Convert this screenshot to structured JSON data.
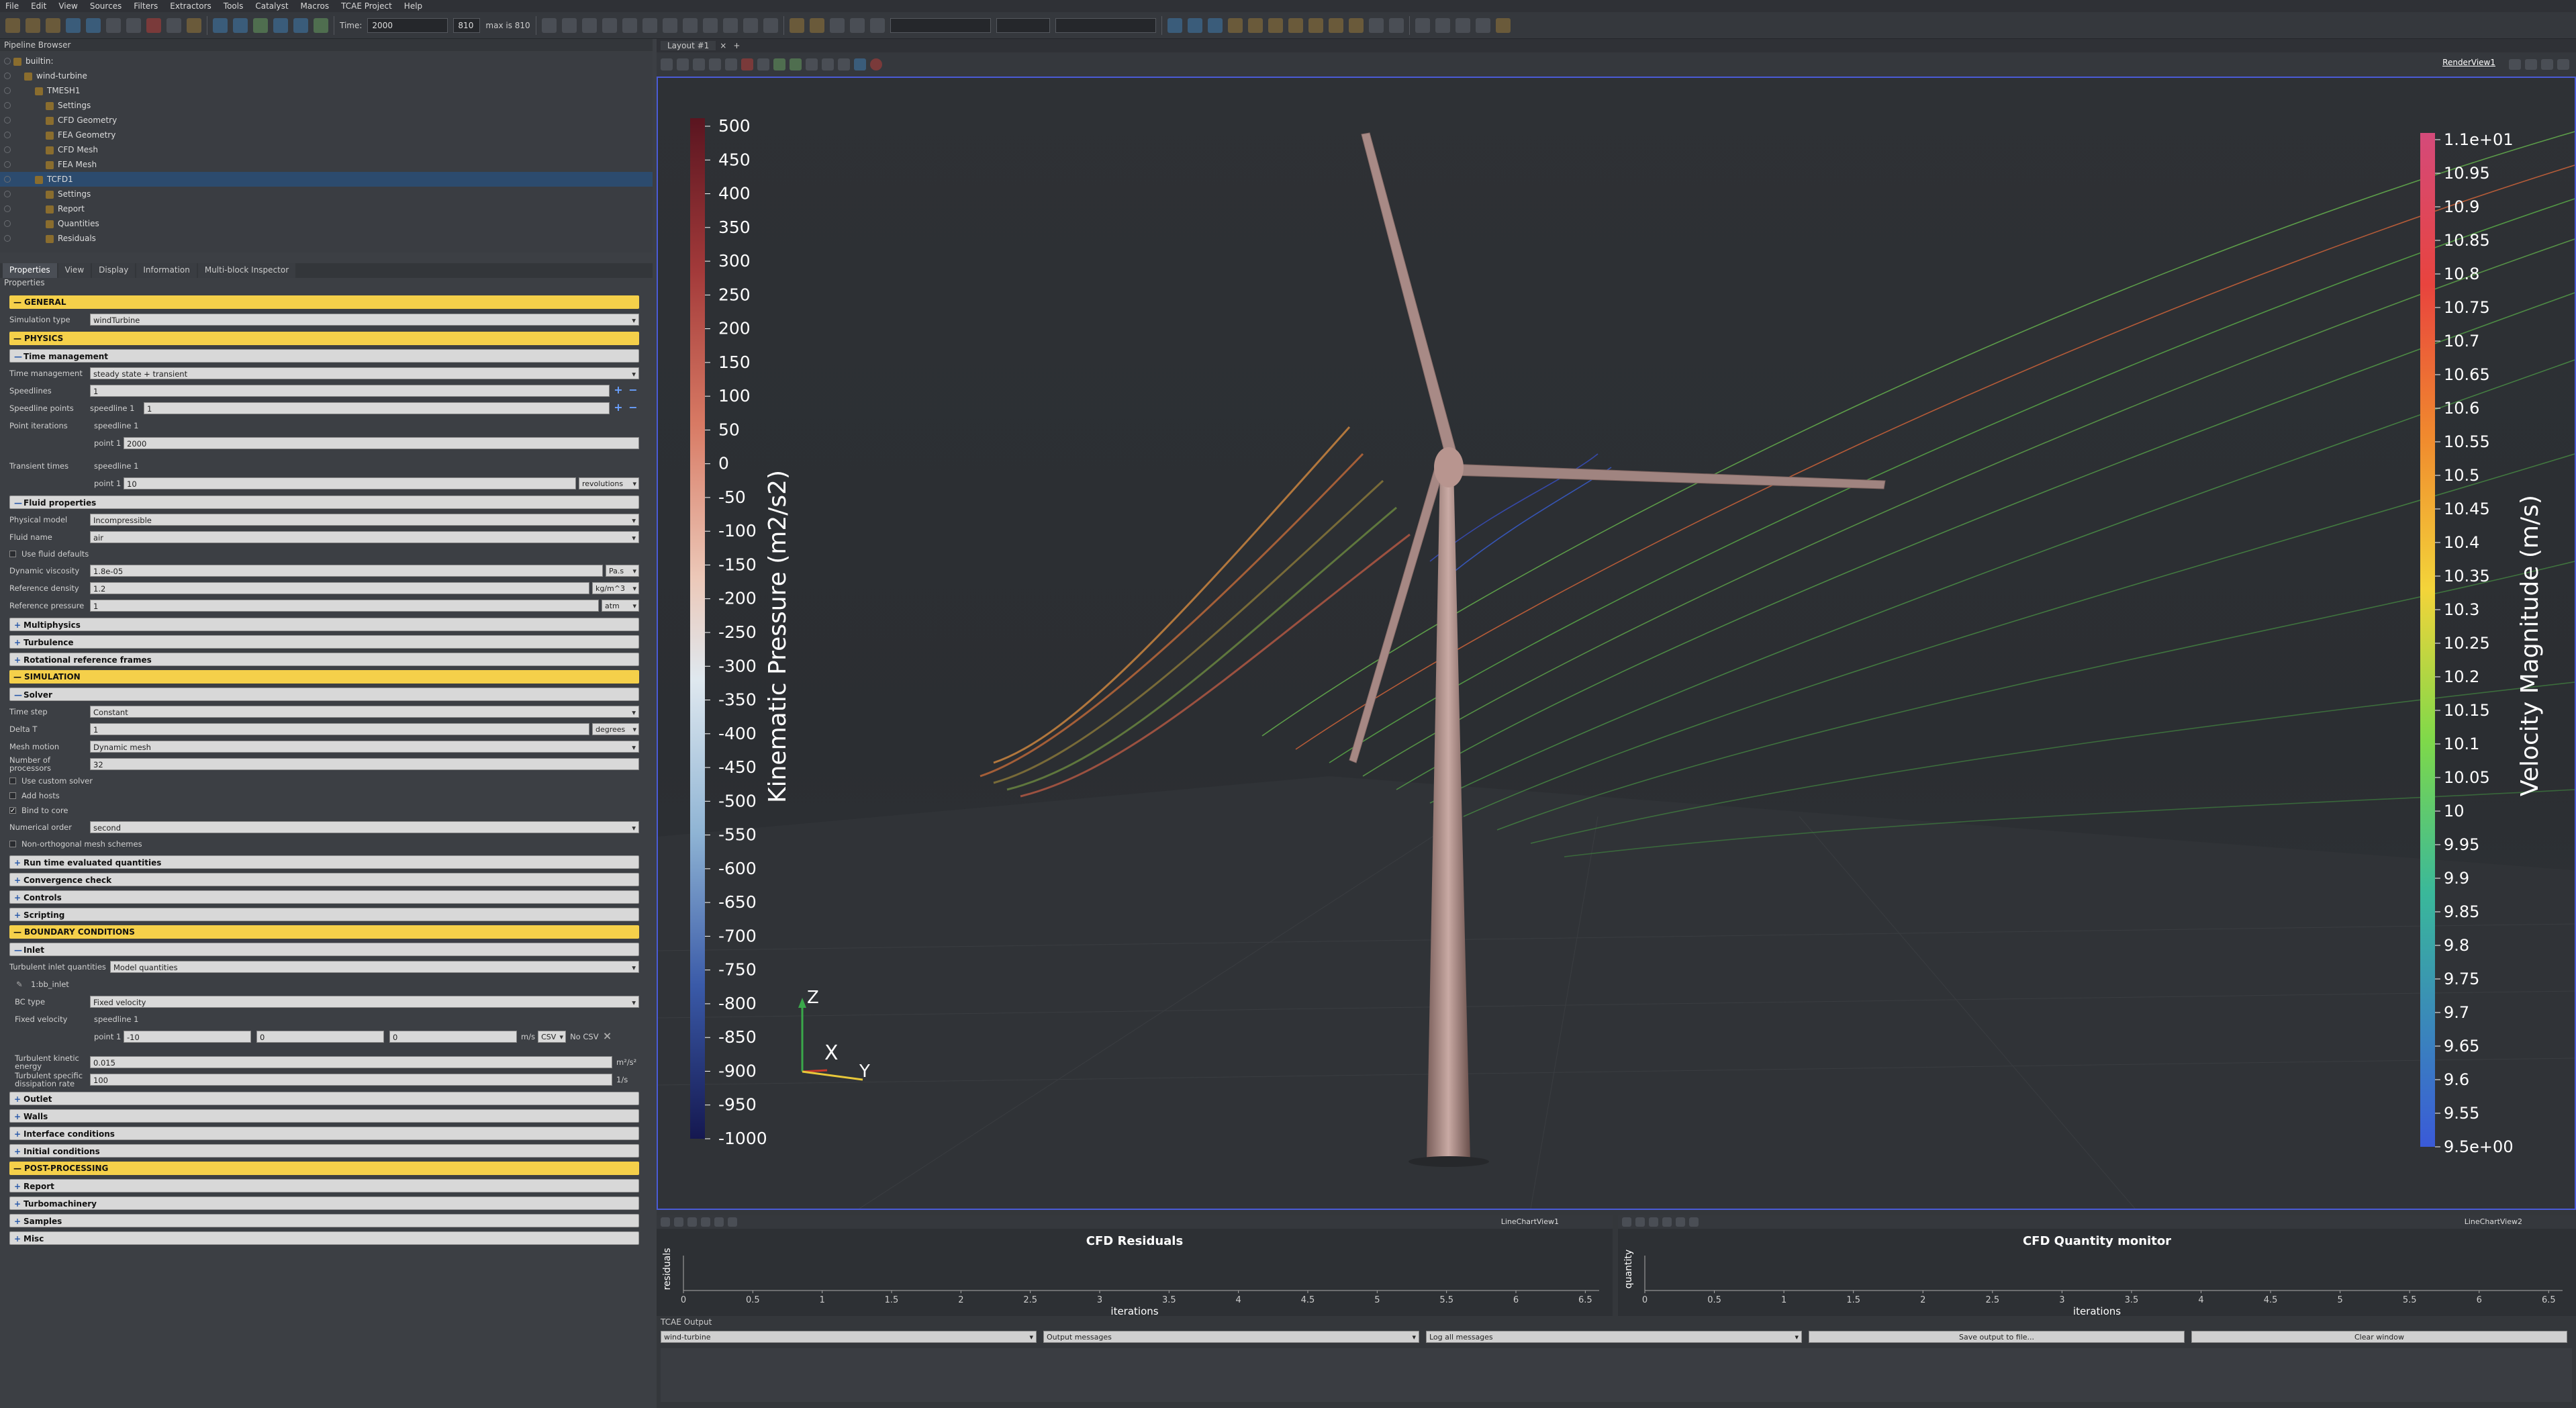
{
  "menu": [
    "File",
    "Edit",
    "View",
    "Sources",
    "Filters",
    "Extractors",
    "Tools",
    "Catalyst",
    "Macros",
    "TCAE Project",
    "Help"
  ],
  "toolbar": {
    "time_label": "Time:",
    "time_value": "2000",
    "step_value": "810",
    "max_label": "max is 810"
  },
  "pipeline": {
    "title": "Pipeline Browser",
    "items": [
      {
        "label": "builtin:",
        "indent": 0
      },
      {
        "label": "wind-turbine",
        "indent": 1
      },
      {
        "label": "TMESH1",
        "indent": 2
      },
      {
        "label": "Settings",
        "indent": 3
      },
      {
        "label": "CFD Geometry",
        "indent": 3
      },
      {
        "label": "FEA Geometry",
        "indent": 3
      },
      {
        "label": "CFD Mesh",
        "indent": 3
      },
      {
        "label": "FEA Mesh",
        "indent": 3
      },
      {
        "label": "TCFD1",
        "indent": 2,
        "selected": true
      },
      {
        "label": "Settings",
        "indent": 3
      },
      {
        "label": "Report",
        "indent": 3
      },
      {
        "label": "Quantities",
        "indent": 3
      },
      {
        "label": "Residuals",
        "indent": 3
      }
    ]
  },
  "tabs": [
    "Properties",
    "View",
    "Display",
    "Information",
    "Multi-block Inspector"
  ],
  "properties_title": "Properties",
  "general": {
    "title": "GENERAL",
    "sim_type_label": "Simulation type",
    "sim_type": "windTurbine"
  },
  "physics": {
    "title": "PHYSICS",
    "time_mgmt": {
      "title": "Time management",
      "tm_label": "Time management",
      "tm_value": "steady state + transient",
      "speedlines_label": "Speedlines",
      "speedlines_value": "1",
      "speedline_points_label": "Speedline points",
      "sp_name": "speedline 1",
      "sp_value": "1",
      "point_iter_label": "Point iterations",
      "pi_name": "speedline 1",
      "pi_point": "point 1",
      "pi_value": "2000",
      "transient_label": "Transient times",
      "tt_name": "speedline 1",
      "tt_point": "point 1",
      "tt_value": "10",
      "tt_unit": "revolutions"
    },
    "fluid": {
      "title": "Fluid properties",
      "pm_label": "Physical model",
      "pm_value": "Incompressible",
      "fn_label": "Fluid name",
      "fn_value": "air",
      "defaults_label": "Use fluid defaults",
      "dv_label": "Dynamic viscosity",
      "dv_value": "1.8e-05",
      "dv_unit": "Pa.s",
      "rd_label": "Reference density",
      "rd_value": "1.2",
      "rd_unit": "kg/m^3",
      "rp_label": "Reference pressure",
      "rp_value": "1",
      "rp_unit": "atm"
    },
    "collapsed": [
      "Multiphysics",
      "Turbulence",
      "Rotational reference frames"
    ]
  },
  "simulation": {
    "title": "SIMULATION",
    "solver": {
      "title": "Solver",
      "ts_label": "Time step",
      "ts_value": "Constant",
      "dt_label": "Delta T",
      "dt_value": "1",
      "dt_unit": "degrees",
      "mm_label": "Mesh motion",
      "mm_value": "Dynamic mesh",
      "np_label": "Number of processors",
      "np_value": "32",
      "custom_solver": "Use custom solver",
      "add_hosts": "Add hosts",
      "bind_core": "Bind to core",
      "no_label": "Numerical order",
      "no_value": "second",
      "nonortho": "Non-orthogonal mesh schemes"
    },
    "collapsed": [
      "Run time evaluated quantities",
      "Convergence check",
      "Controls",
      "Scripting"
    ]
  },
  "boundary": {
    "title": "BOUNDARY CONDITIONS",
    "inlet": {
      "title": "Inlet",
      "tiq_label": "Turbulent inlet quantities",
      "tiq_value": "Model quantities",
      "patch": "1:bb_inlet",
      "bc_label": "BC type",
      "bc_value": "Fixed velocity",
      "fv_label": "Fixed velocity",
      "fv_name": "speedline 1",
      "fv_point": "point 1",
      "fv_x": "-10",
      "fv_y": "0",
      "fv_z": "0",
      "fv_unit": "m/s",
      "fv_csv": "CSV",
      "fv_nocsv": "No CSV",
      "tke_label": "Turbulent kinetic energy",
      "tke_value": "0.015",
      "tke_unit": "m²/s²",
      "tsd_label": "Turbulent specific dissipation rate",
      "tsd_value": "100",
      "tsd_unit": "1/s"
    },
    "collapsed": [
      "Outlet",
      "Walls",
      "Interface conditions",
      "Initial conditions"
    ]
  },
  "post": {
    "title": "POST-PROCESSING",
    "collapsed": [
      "Report",
      "Turbomachinery",
      "Samples",
      "Misc"
    ]
  },
  "layout": {
    "tab": "Layout #1",
    "view_name": "RenderView1"
  },
  "pressure_bar": {
    "title": "Kinematic Pressure (m2/s2)",
    "ticks": [
      "500",
      "450",
      "400",
      "350",
      "300",
      "250",
      "200",
      "150",
      "100",
      "50",
      "0",
      "-50",
      "-100",
      "-150",
      "-200",
      "-250",
      "-300",
      "-350",
      "-400",
      "-450",
      "-500",
      "-550",
      "-600",
      "-650",
      "-700",
      "-750",
      "-800",
      "-850",
      "-900",
      "-950",
      "-1000"
    ]
  },
  "velocity_bar": {
    "title": "Velocity Magnitude (m/s)",
    "ticks": [
      "1.1e+01",
      "10.95",
      "10.9",
      "10.85",
      "10.8",
      "10.75",
      "10.7",
      "10.65",
      "10.6",
      "10.55",
      "10.5",
      "10.45",
      "10.4",
      "10.35",
      "10.3",
      "10.25",
      "10.2",
      "10.15",
      "10.1",
      "10.05",
      "10",
      "9.95",
      "9.9",
      "9.85",
      "9.8",
      "9.75",
      "9.7",
      "9.65",
      "9.6",
      "9.55",
      "9.5e+00"
    ]
  },
  "axes": {
    "z": "Z",
    "x": "X",
    "y": "Y"
  },
  "charts": [
    {
      "view": "LineChartView1",
      "title": "CFD Residuals",
      "ylabel": "residuals",
      "xlabel": "iterations"
    },
    {
      "view": "LineChartView2",
      "title": "CFD Quantity monitor",
      "ylabel": "quantity",
      "xlabel": "iterations"
    }
  ],
  "chart_ticks": [
    "0",
    "0.5",
    "1",
    "1.5",
    "2",
    "2.5",
    "3",
    "3.5",
    "4",
    "4.5",
    "5",
    "5.5",
    "6",
    "6.5"
  ],
  "output": {
    "title": "TCAE Output",
    "source": "wind-turbine",
    "type": "Output messages",
    "level": "Log all messages",
    "save": "Save output to file...",
    "clear": "Clear window"
  },
  "colors": {
    "section": "#f5d04a",
    "render_border": "#4a5bd6",
    "turbine": "#a88a86"
  }
}
